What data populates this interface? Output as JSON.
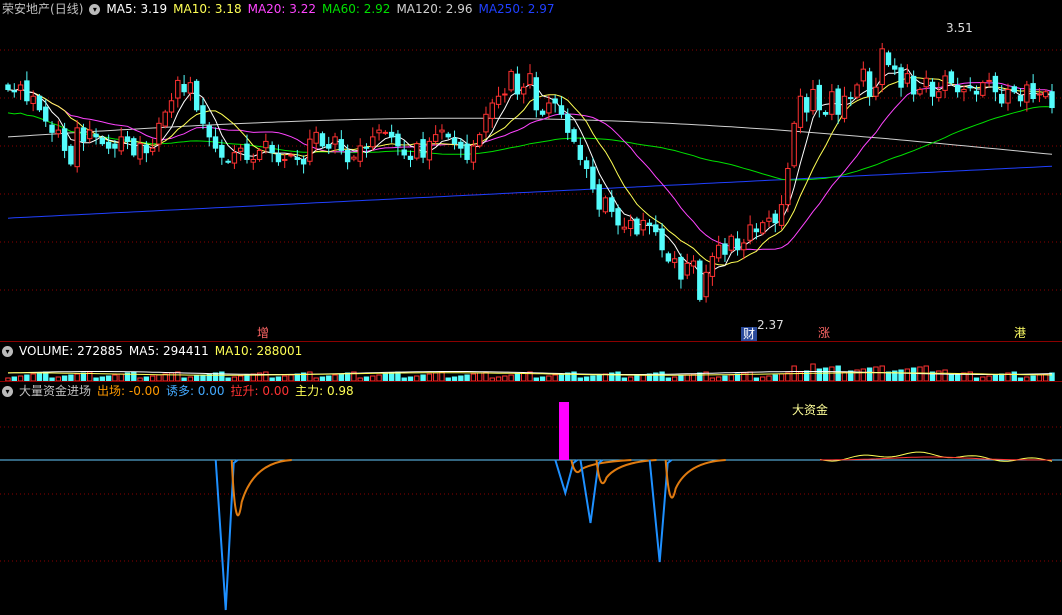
{
  "main": {
    "stock_name": "荣安地产",
    "period": "(日线)",
    "indicators": [
      {
        "label": "MA5: 3.19",
        "color": "#ffffff"
      },
      {
        "label": "MA10: 3.18",
        "color": "#ffff55"
      },
      {
        "label": "MA20: 3.22",
        "color": "#ff44ff"
      },
      {
        "label": "MA60: 2.92",
        "color": "#00e000"
      },
      {
        "label": "MA120: 2.96",
        "color": "#d0d0d0"
      },
      {
        "label": "MA250: 2.97",
        "color": "#2040ff"
      }
    ],
    "high_mark": "3.51",
    "low_mark": "2.37",
    "event_tags": [
      {
        "text": "增",
        "bg": "#000000",
        "color": "#ff6666"
      },
      {
        "text": "财",
        "bg": "#2a4a9a",
        "color": "#ffffff"
      },
      {
        "text": "涨",
        "bg": "#000000",
        "color": "#ff6666"
      },
      {
        "text": "港",
        "bg": "#000000",
        "color": "#ffff66"
      }
    ]
  },
  "volume": {
    "indicators": [
      {
        "label": "VOLUME: 272885",
        "color": "#ffffff"
      },
      {
        "label": "MA5: 294411",
        "color": "#ffffff"
      },
      {
        "label": "MA10: 288001",
        "color": "#ffff55"
      }
    ]
  },
  "indicator_panel": {
    "name": "大量资金进场",
    "indicators": [
      {
        "label": "出场: -0.00",
        "color": "#ff9900"
      },
      {
        "label": "诱多: 0.00",
        "color": "#44aaff"
      },
      {
        "label": "拉升: 0.00",
        "color": "#ff3333"
      },
      {
        "label": "主力: 0.98",
        "color": "#ffff55"
      }
    ],
    "big_money_label": "大资金"
  },
  "colors": {
    "up": "#ff3232",
    "down": "#54fcfc",
    "grid": "#8b0000",
    "ma5": "#ffffff",
    "ma10": "#ffff55",
    "ma20": "#ff44ff",
    "ma60": "#00e000",
    "ma120": "#d0d0d0",
    "ma250": "#2040ff",
    "blue_line": "#1e90ff",
    "orange_line": "#e07b10",
    "magenta_bar": "#ff00ff"
  },
  "chart_data": {
    "type": "candlestick",
    "price_range": [
      2.37,
      3.51
    ],
    "prices": [
      3.31,
      3.3,
      3.33,
      3.26,
      3.28,
      3.22,
      3.17,
      3.12,
      3.13,
      3.04,
      2.98,
      3.14,
      3.08,
      3.13,
      3.1,
      3.07,
      3.05,
      3.05,
      3.1,
      3.08,
      3.02,
      3.07,
      3.03,
      3.05,
      3.16,
      3.21,
      3.26,
      3.35,
      3.3,
      3.34,
      3.22,
      3.16,
      3.1,
      3.05,
      3.01,
      2.99,
      3.03,
      3.05,
      3.0,
      3.0,
      3.04,
      3.08,
      3.03,
      2.99,
      3.0,
      3.02,
      3.0,
      2.98,
      3.09,
      3.12,
      3.06,
      3.05,
      3.1,
      3.04,
      2.99,
      3.01,
      3.06,
      3.05,
      3.1,
      3.13,
      3.12,
      3.1,
      3.06,
      3.02,
      3.0,
      3.07,
      3.01,
      3.08,
      3.11,
      3.13,
      3.1,
      3.07,
      3.05,
      3.0,
      3.06,
      3.11,
      3.2,
      3.25,
      3.28,
      3.29,
      3.39,
      3.29,
      3.32,
      3.38,
      3.22,
      3.2,
      3.25,
      3.25,
      3.2,
      3.12,
      3.08,
      3.0,
      2.96,
      2.87,
      2.78,
      2.83,
      2.77,
      2.71,
      2.7,
      2.73,
      2.67,
      2.73,
      2.71,
      2.68,
      2.6,
      2.55,
      2.56,
      2.47,
      2.54,
      2.55,
      2.38,
      2.5,
      2.57,
      2.62,
      2.58,
      2.66,
      2.6,
      2.63,
      2.71,
      2.68,
      2.72,
      2.74,
      2.72,
      2.8,
      2.96,
      3.16,
      3.28,
      3.21,
      3.31,
      3.22,
      3.2,
      3.3,
      3.2,
      3.28,
      3.27,
      3.33,
      3.4,
      3.28,
      3.32,
      3.49,
      3.42,
      3.4,
      3.32,
      3.38,
      3.29,
      3.31,
      3.36,
      3.28,
      3.3,
      3.37,
      3.34,
      3.3,
      3.31,
      3.32,
      3.29,
      3.34,
      3.35,
      3.3,
      3.25,
      3.31,
      3.3,
      3.26,
      3.33,
      3.27,
      3.29,
      3.3,
      3.23
    ],
    "volumes": [
      1,
      1,
      1,
      1,
      1,
      1,
      1,
      1,
      1,
      1,
      1,
      1,
      1,
      1,
      1,
      1,
      1,
      1,
      1,
      1,
      1,
      1,
      1,
      1,
      1,
      1,
      1,
      1,
      1,
      1,
      1,
      1,
      1,
      1,
      1,
      1,
      1,
      1,
      1,
      1,
      1,
      1,
      1,
      1,
      1,
      1,
      1,
      1,
      1,
      1,
      1,
      1,
      1,
      1,
      1,
      1,
      1,
      1,
      1,
      1,
      1,
      1,
      1,
      1,
      1,
      1,
      1,
      1,
      1,
      1,
      1,
      1,
      1,
      1,
      1,
      1,
      1,
      1,
      1,
      1,
      1,
      1,
      1,
      1,
      1,
      1,
      1,
      1,
      1,
      1,
      1,
      1,
      1,
      1,
      1,
      1,
      1,
      1,
      1,
      1,
      1,
      1,
      1,
      1,
      1,
      1,
      1,
      1,
      1,
      1,
      1,
      1,
      1,
      1,
      1,
      1,
      1,
      1,
      1,
      1,
      1,
      1,
      1,
      1,
      1,
      1,
      1,
      1,
      1,
      1,
      1,
      1,
      1,
      1,
      1,
      1,
      1,
      1,
      1,
      1,
      1,
      1,
      1,
      1,
      1,
      1,
      1,
      1,
      1,
      1,
      1,
      1,
      1,
      1,
      1,
      1,
      1,
      1,
      1,
      1,
      1,
      1,
      1,
      1,
      1,
      1,
      1,
      1,
      1,
      1
    ],
    "indicator_spikes": [
      {
        "index": 82,
        "depth": 1.0
      },
      {
        "index": 136,
        "depth": 0.22
      },
      {
        "index": 140,
        "depth": 0.42
      },
      {
        "index": 151,
        "depth": 0.68
      }
    ],
    "magenta_bar_index": 128
  }
}
